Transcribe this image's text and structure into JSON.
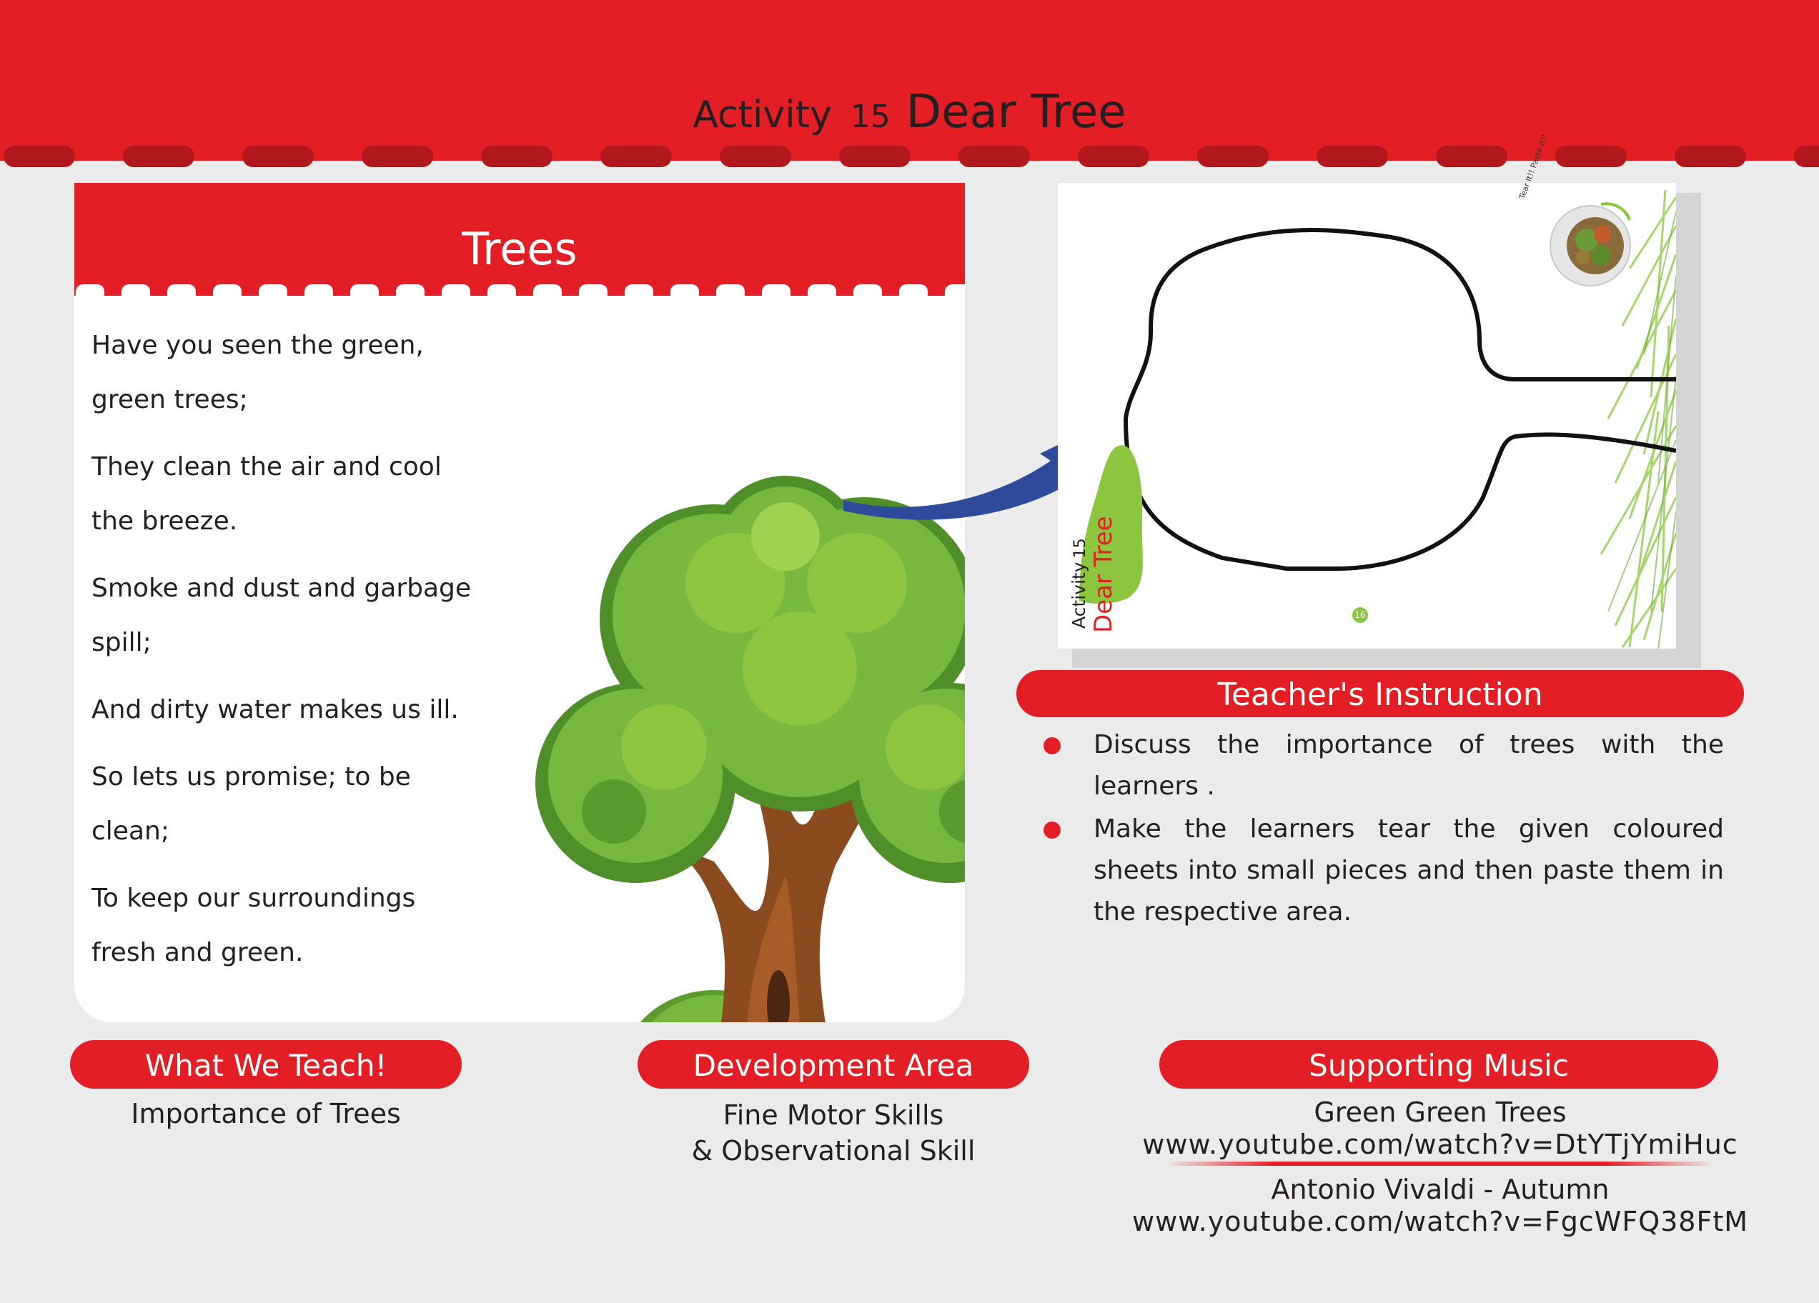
{
  "header": {
    "activity_label": "Activity",
    "activity_number": "15",
    "title": "Dear Tree"
  },
  "poem": {
    "title": "Trees",
    "lines": [
      "Have you seen the green,",
      "green trees;",
      "They clean the air and cool",
      "the breeze.",
      "Smoke and dust and garbage",
      "spill;",
      "And dirty water makes us ill.",
      "So lets us promise; to be",
      "clean;",
      "To keep our surroundings",
      "fresh and green."
    ]
  },
  "activity_sheet": {
    "activity_label": "Activity",
    "activity_number": "15",
    "title": "Dear Tree",
    "page_number": "16",
    "badge_text": "Tear It!! Paste It!!"
  },
  "teacher_instruction": {
    "title": "Teacher's Instruction",
    "items": [
      "Discuss the importance of trees with the learners .",
      "Make the learners tear the given coloured sheets into small pieces and then paste them in the respective area."
    ]
  },
  "what_we_teach": {
    "title": "What We Teach!",
    "text": "Importance of Trees"
  },
  "development_area": {
    "title": "Development Area",
    "line1": "Fine Motor Skills",
    "line2": "& Observational  Skill"
  },
  "supporting_music": {
    "title": "Supporting Music",
    "song1": "Green Green Trees",
    "url1": "www.youtube.com/watch?v=DtYTjYmiHuc",
    "song2": "Antonio Vivaldi - Autumn",
    "url2": "www.youtube.com/watch?v=FgcWFQ38FtM"
  },
  "colors": {
    "brand_red": "#e31e24",
    "stitch_red": "#b0181c",
    "leaf_green": "#8cc63f",
    "arrow_blue": "#2e4b9b"
  }
}
